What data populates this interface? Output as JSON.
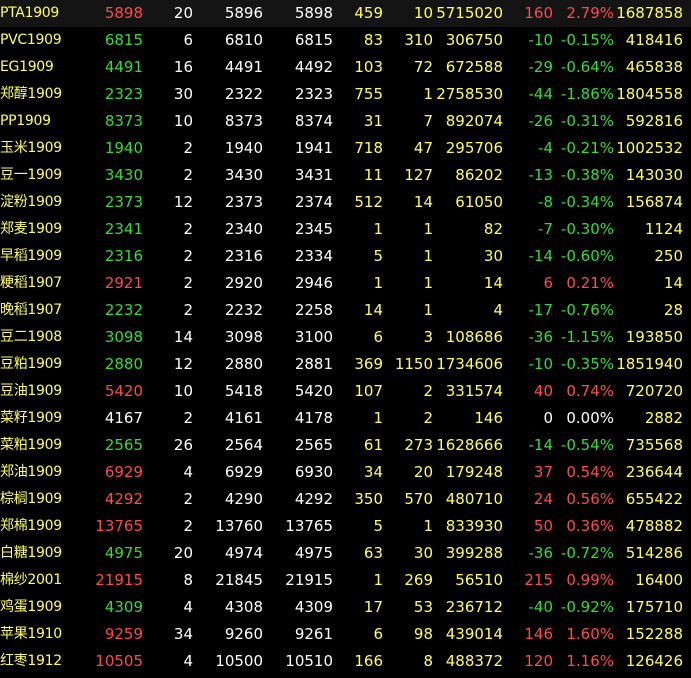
{
  "colors": {
    "background": "#000000",
    "up": "#ff4a4a",
    "down": "#33dd33",
    "flat": "#ffffff",
    "name": "#ffff55",
    "neutral": "#ffffff",
    "volume": "#ffff55"
  },
  "rows": [
    {
      "name": "PTA1909",
      "last": "5898",
      "last_vol": "20",
      "bid": "5896",
      "ask": "5898",
      "bid_vol": "459",
      "ask_vol": "10",
      "volume": "5715020",
      "change": "160",
      "pct": "2.79%",
      "open_interest": "1687858",
      "dir": "up"
    },
    {
      "name": "PVC1909",
      "last": "6815",
      "last_vol": "6",
      "bid": "6810",
      "ask": "6815",
      "bid_vol": "83",
      "ask_vol": "310",
      "volume": "306750",
      "change": "-10",
      "pct": "-0.15%",
      "open_interest": "418416",
      "dir": "down"
    },
    {
      "name": "EG1909",
      "last": "4491",
      "last_vol": "16",
      "bid": "4491",
      "ask": "4492",
      "bid_vol": "103",
      "ask_vol": "72",
      "volume": "672588",
      "change": "-29",
      "pct": "-0.64%",
      "open_interest": "465838",
      "dir": "down"
    },
    {
      "name": "郑醇1909",
      "last": "2323",
      "last_vol": "30",
      "bid": "2322",
      "ask": "2323",
      "bid_vol": "755",
      "ask_vol": "1",
      "volume": "2758530",
      "change": "-44",
      "pct": "-1.86%",
      "open_interest": "1804558",
      "dir": "down"
    },
    {
      "name": "PP1909",
      "last": "8373",
      "last_vol": "10",
      "bid": "8373",
      "ask": "8374",
      "bid_vol": "31",
      "ask_vol": "7",
      "volume": "892074",
      "change": "-26",
      "pct": "-0.31%",
      "open_interest": "592816",
      "dir": "down"
    },
    {
      "name": "玉米1909",
      "last": "1940",
      "last_vol": "2",
      "bid": "1940",
      "ask": "1941",
      "bid_vol": "718",
      "ask_vol": "47",
      "volume": "295706",
      "change": "-4",
      "pct": "-0.21%",
      "open_interest": "1002532",
      "dir": "down"
    },
    {
      "name": "豆一1909",
      "last": "3430",
      "last_vol": "2",
      "bid": "3430",
      "ask": "3431",
      "bid_vol": "11",
      "ask_vol": "127",
      "volume": "86202",
      "change": "-13",
      "pct": "-0.38%",
      "open_interest": "143030",
      "dir": "down"
    },
    {
      "name": "淀粉1909",
      "last": "2373",
      "last_vol": "12",
      "bid": "2373",
      "ask": "2374",
      "bid_vol": "512",
      "ask_vol": "14",
      "volume": "61050",
      "change": "-8",
      "pct": "-0.34%",
      "open_interest": "156874",
      "dir": "down"
    },
    {
      "name": "郑麦1909",
      "last": "2341",
      "last_vol": "2",
      "bid": "2340",
      "ask": "2345",
      "bid_vol": "1",
      "ask_vol": "1",
      "volume": "82",
      "change": "-7",
      "pct": "-0.30%",
      "open_interest": "1124",
      "dir": "down"
    },
    {
      "name": "早稻1909",
      "last": "2316",
      "last_vol": "2",
      "bid": "2316",
      "ask": "2334",
      "bid_vol": "5",
      "ask_vol": "1",
      "volume": "30",
      "change": "-14",
      "pct": "-0.60%",
      "open_interest": "250",
      "dir": "down"
    },
    {
      "name": "粳稻1907",
      "last": "2921",
      "last_vol": "2",
      "bid": "2920",
      "ask": "2946",
      "bid_vol": "1",
      "ask_vol": "1",
      "volume": "14",
      "change": "6",
      "pct": "0.21%",
      "open_interest": "14",
      "dir": "up"
    },
    {
      "name": "晚稻1907",
      "last": "2232",
      "last_vol": "2",
      "bid": "2232",
      "ask": "2258",
      "bid_vol": "14",
      "ask_vol": "1",
      "volume": "4",
      "change": "-17",
      "pct": "-0.76%",
      "open_interest": "28",
      "dir": "down"
    },
    {
      "name": "豆二1908",
      "last": "3098",
      "last_vol": "14",
      "bid": "3098",
      "ask": "3100",
      "bid_vol": "6",
      "ask_vol": "3",
      "volume": "108686",
      "change": "-36",
      "pct": "-1.15%",
      "open_interest": "193850",
      "dir": "down"
    },
    {
      "name": "豆粕1909",
      "last": "2880",
      "last_vol": "12",
      "bid": "2880",
      "ask": "2881",
      "bid_vol": "369",
      "ask_vol": "1150",
      "volume": "1734606",
      "change": "-10",
      "pct": "-0.35%",
      "open_interest": "1851940",
      "dir": "down"
    },
    {
      "name": "豆油1909",
      "last": "5420",
      "last_vol": "10",
      "bid": "5418",
      "ask": "5420",
      "bid_vol": "107",
      "ask_vol": "2",
      "volume": "331574",
      "change": "40",
      "pct": "0.74%",
      "open_interest": "720720",
      "dir": "up"
    },
    {
      "name": "菜籽1909",
      "last": "4167",
      "last_vol": "2",
      "bid": "4161",
      "ask": "4178",
      "bid_vol": "1",
      "ask_vol": "2",
      "volume": "146",
      "change": "0",
      "pct": "0.00%",
      "open_interest": "2882",
      "dir": "flat"
    },
    {
      "name": "菜粕1909",
      "last": "2565",
      "last_vol": "26",
      "bid": "2564",
      "ask": "2565",
      "bid_vol": "61",
      "ask_vol": "273",
      "volume": "1628666",
      "change": "-14",
      "pct": "-0.54%",
      "open_interest": "735568",
      "dir": "down"
    },
    {
      "name": "郑油1909",
      "last": "6929",
      "last_vol": "4",
      "bid": "6929",
      "ask": "6930",
      "bid_vol": "34",
      "ask_vol": "20",
      "volume": "179248",
      "change": "37",
      "pct": "0.54%",
      "open_interest": "236644",
      "dir": "up"
    },
    {
      "name": "棕榈1909",
      "last": "4292",
      "last_vol": "2",
      "bid": "4290",
      "ask": "4292",
      "bid_vol": "350",
      "ask_vol": "570",
      "volume": "480710",
      "change": "24",
      "pct": "0.56%",
      "open_interest": "655422",
      "dir": "up"
    },
    {
      "name": "郑棉1909",
      "last": "13765",
      "last_vol": "2",
      "bid": "13760",
      "ask": "13765",
      "bid_vol": "5",
      "ask_vol": "1",
      "volume": "833930",
      "change": "50",
      "pct": "0.36%",
      "open_interest": "478882",
      "dir": "up"
    },
    {
      "name": "白糖1909",
      "last": "4975",
      "last_vol": "20",
      "bid": "4974",
      "ask": "4975",
      "bid_vol": "63",
      "ask_vol": "30",
      "volume": "399288",
      "change": "-36",
      "pct": "-0.72%",
      "open_interest": "514286",
      "dir": "down"
    },
    {
      "name": "棉纱2001",
      "last": "21915",
      "last_vol": "8",
      "bid": "21845",
      "ask": "21915",
      "bid_vol": "1",
      "ask_vol": "269",
      "volume": "56510",
      "change": "215",
      "pct": "0.99%",
      "open_interest": "16400",
      "dir": "up"
    },
    {
      "name": "鸡蛋1909",
      "last": "4309",
      "last_vol": "4",
      "bid": "4308",
      "ask": "4309",
      "bid_vol": "17",
      "ask_vol": "53",
      "volume": "236712",
      "change": "-40",
      "pct": "-0.92%",
      "open_interest": "175710",
      "dir": "down"
    },
    {
      "name": "苹果1910",
      "last": "9259",
      "last_vol": "34",
      "bid": "9260",
      "ask": "9261",
      "bid_vol": "6",
      "ask_vol": "98",
      "volume": "439014",
      "change": "146",
      "pct": "1.60%",
      "open_interest": "152288",
      "dir": "up"
    },
    {
      "name": "红枣1912",
      "last": "10505",
      "last_vol": "4",
      "bid": "10500",
      "ask": "10510",
      "bid_vol": "166",
      "ask_vol": "8",
      "volume": "488372",
      "change": "120",
      "pct": "1.16%",
      "open_interest": "126426",
      "dir": "up"
    }
  ]
}
